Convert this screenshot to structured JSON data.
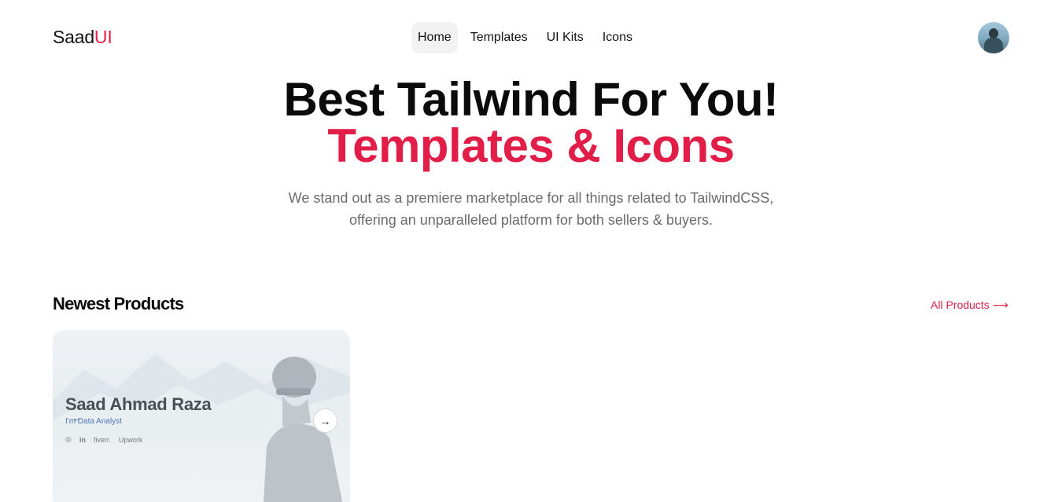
{
  "header": {
    "logo_main": "Saad",
    "logo_accent": "UI",
    "nav": [
      {
        "label": "Home",
        "active": true
      },
      {
        "label": "Templates",
        "active": false
      },
      {
        "label": "UI Kits",
        "active": false
      },
      {
        "label": "Icons",
        "active": false
      }
    ],
    "avatar_icon": "user-avatar"
  },
  "hero": {
    "title_line1": "Best Tailwind For You!",
    "title_line2": "Templates & Icons",
    "subtitle_line1": "We stand out as a premiere marketplace for all things related to TailwindCSS,",
    "subtitle_line2": "offering an unparalleled platform for both sellers & buyers."
  },
  "products": {
    "section_title": "Newest Products",
    "all_link": "All Products ⟶",
    "cards": [
      {
        "name": "Saad Ahmad Raza",
        "role": "I'm Data Analyst",
        "social": [
          "◎",
          "in",
          "fiverr.",
          "Upwork"
        ],
        "prev_icon": "arrow-left-icon",
        "next_icon": "arrow-right-icon"
      }
    ]
  },
  "colors": {
    "accent": "#e11d48",
    "text": "#0b0b0b",
    "muted": "#6b6b6b"
  }
}
